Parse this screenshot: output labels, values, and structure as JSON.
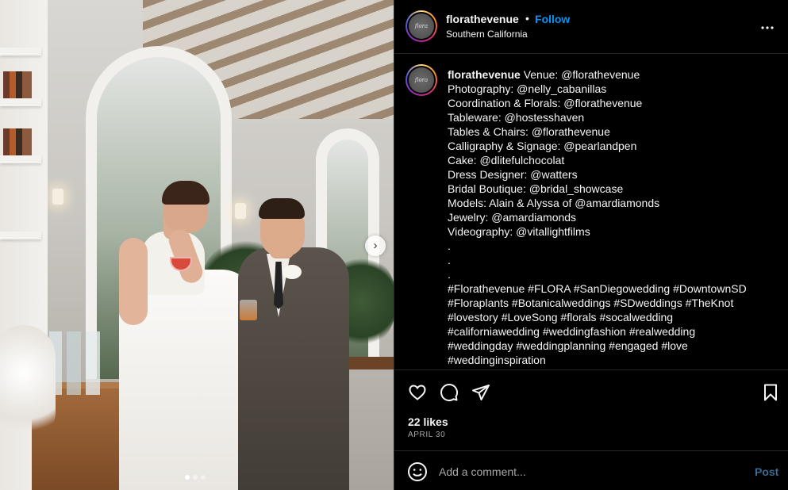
{
  "post": {
    "photo_alt": "Couple laughing at a bar in a wedding venue",
    "carousel": {
      "count": 3,
      "active": 0,
      "next_icon": "chevron-right-icon"
    }
  },
  "header": {
    "username": "florathevenue",
    "separator": "•",
    "follow_label": "Follow",
    "location": "Southern California",
    "avatar_text": "flora",
    "more_icon": "more-horizontal-icon"
  },
  "caption": {
    "username": "florathevenue",
    "first_line_rest": " Venue: @florathevenue",
    "lines": [
      "Photography: @nelly_cabanillas",
      "Coordination & Florals: @florathevenue",
      "Tableware: @hostesshaven",
      "Tables & Chairs: @florathevenue",
      "Calligraphy & Signage: @pearlandpen",
      "Cake: @dlitefulchocolat",
      "Dress Designer: @watters",
      "Bridal Boutique: @bridal_showcase",
      "Models: Alain & Alyssa of @amardiamonds",
      "Jewelry: @amardiamonds",
      "Videography: @vitallightfilms",
      ".",
      ".",
      ".",
      "#Florathevenue #FLORA #SanDiegowedding #DowntownSD",
      "#Floraplants #Botanicalweddings #SDweddings #TheKnot",
      "#lovestory #LoveSong #florals #socalwedding",
      "#californiawedding #weddingfashion #realwedding",
      "#weddingday #weddingplanning #engaged #love",
      "#weddinginspiration"
    ]
  },
  "actions": {
    "like_icon": "heart-icon",
    "comment_icon": "comment-icon",
    "share_icon": "send-icon",
    "save_icon": "bookmark-icon",
    "likes": "22 likes",
    "date": "APRIL 30"
  },
  "comment": {
    "emoji_icon": "emoji-icon",
    "placeholder": "Add a comment...",
    "post_label": "Post"
  },
  "colors": {
    "background": "#000000",
    "text": "#f5f5f5",
    "follow_blue": "#0095f6",
    "muted": "#a8a8a8",
    "post_disabled": "#3d6a8f",
    "divider": "#262626"
  }
}
